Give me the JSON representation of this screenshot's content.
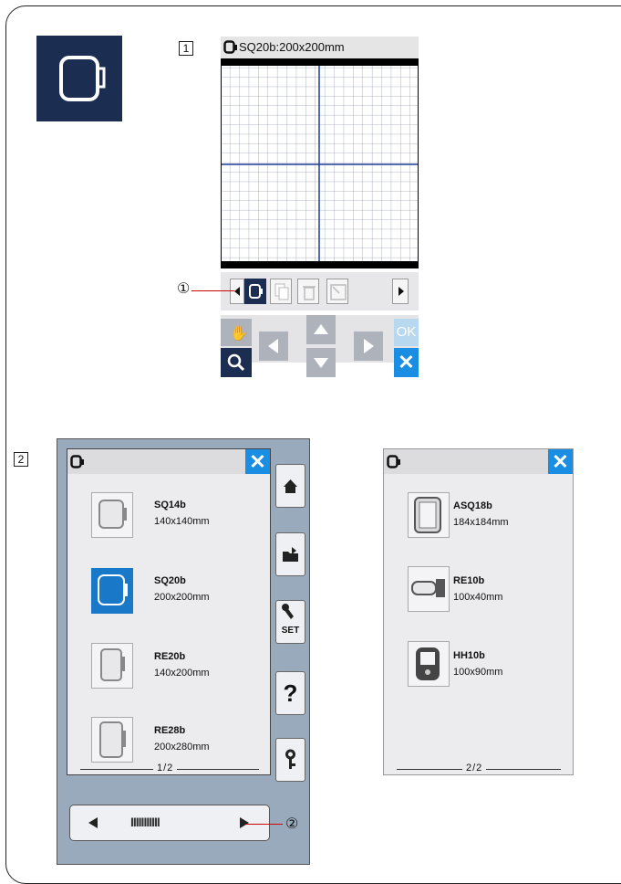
{
  "step1": {
    "number": "1",
    "screen_title": "SQ20b:200x200mm",
    "callout": "①",
    "ok_label": "OK"
  },
  "step2": {
    "number": "2",
    "callout": "②"
  },
  "page1": {
    "items": [
      {
        "name": "SQ14b",
        "size": "140x140mm",
        "icon": "hoop-square-icon"
      },
      {
        "name": "SQ20b",
        "size": "200x200mm",
        "icon": "hoop-square-selected-icon"
      },
      {
        "name": "RE20b",
        "size": "140x200mm",
        "icon": "hoop-rect-icon"
      },
      {
        "name": "RE28b",
        "size": "200x280mm",
        "icon": "hoop-rect-large-icon"
      }
    ],
    "pager": "1/2",
    "set_label": "SET",
    "help_label": "?",
    "scroll_indicator": "IIIIIIIIIII"
  },
  "page2": {
    "items": [
      {
        "name": "ASQ18b",
        "size": "184x184mm",
        "icon": "hoop-asq-icon"
      },
      {
        "name": "RE10b",
        "size": "100x40mm",
        "icon": "hoop-small-icon"
      },
      {
        "name": "HH10b",
        "size": "100x90mm",
        "icon": "hoop-hh-icon"
      }
    ],
    "pager": "2/2"
  }
}
